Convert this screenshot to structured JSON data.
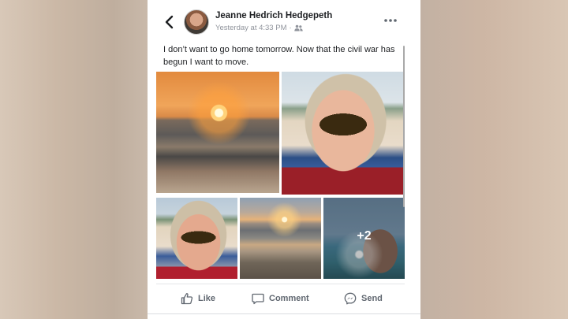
{
  "post": {
    "author": "Jeanne Hedrich Hedgepeth",
    "timestamp": "Yesterday at 4:33 PM",
    "separator": "·",
    "audience_icon": "friends-icon",
    "text": "I don’t want to go home tomorrow. Now that the civil war has begun I want to move."
  },
  "photos": {
    "items": [
      {
        "alt": "sunset over the ocean"
      },
      {
        "alt": "beach selfie with sunglasses"
      },
      {
        "alt": "beach selfie in chair"
      },
      {
        "alt": "sunset on the beach"
      },
      {
        "alt": "selfie in the water"
      }
    ],
    "more_count": "+2"
  },
  "actions": {
    "like_label": "Like",
    "comment_label": "Comment",
    "send_label": "Send"
  },
  "icons": {
    "back": "back-chevron-icon",
    "more": "more-options-icon",
    "like": "thumbs-up-icon",
    "comment": "comment-icon",
    "send": "messenger-icon"
  },
  "colors": {
    "text_primary": "#1c1e21",
    "text_secondary": "#90949c",
    "action_text": "#606770"
  }
}
